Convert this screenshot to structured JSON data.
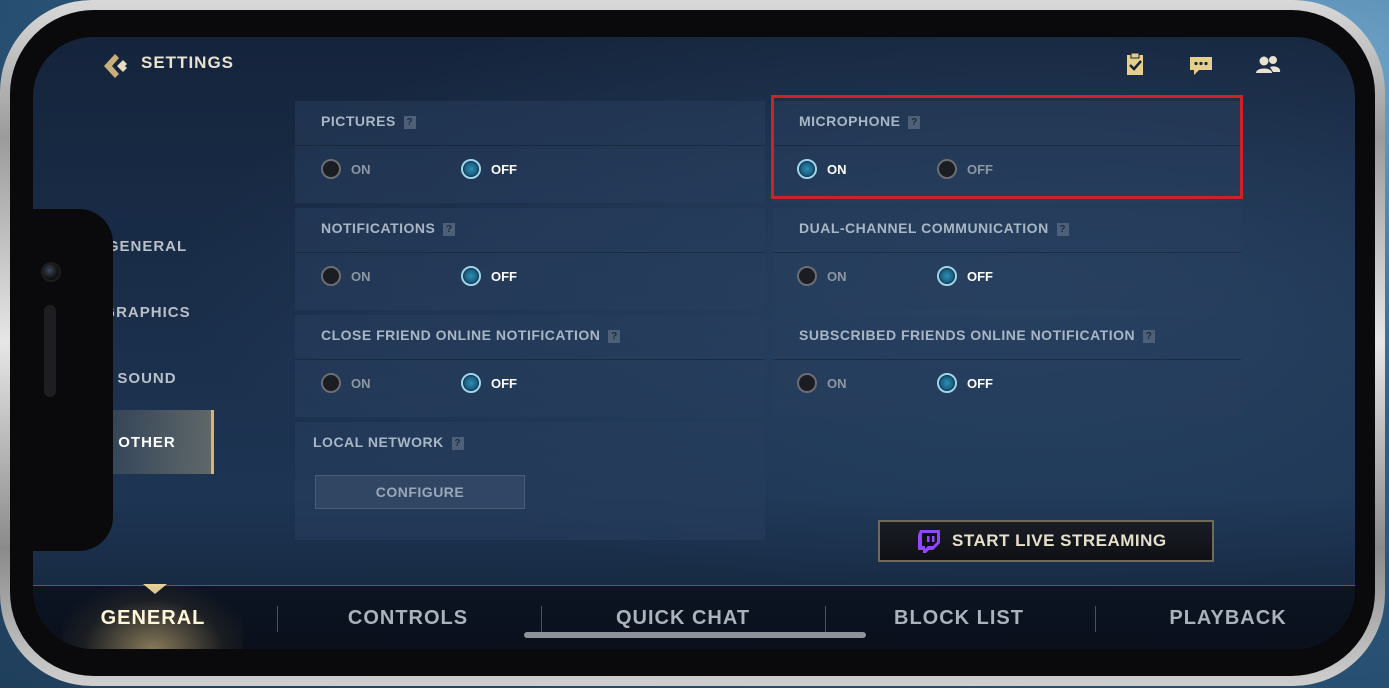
{
  "header": {
    "title": "SETTINGS",
    "icons": [
      "back-icon",
      "clipboard-check-icon",
      "chat-icon",
      "friends-icon"
    ]
  },
  "sidebar": {
    "items": [
      {
        "label": "GENERAL",
        "active": false
      },
      {
        "label": "GRAPHICS",
        "active": false
      },
      {
        "label": "SOUND",
        "active": false
      },
      {
        "label": "OTHER",
        "active": true
      }
    ]
  },
  "settings": {
    "pictures": {
      "label": "PICTURES",
      "hint": "?",
      "on": "ON",
      "off": "OFF",
      "selected": "OFF"
    },
    "microphone": {
      "label": "MICROPHONE",
      "hint": "?",
      "on": "ON",
      "off": "OFF",
      "selected": "ON"
    },
    "notifications": {
      "label": "NOTIFICATIONS",
      "hint": "?",
      "on": "ON",
      "off": "OFF",
      "selected": "OFF"
    },
    "dual_channel": {
      "label": "DUAL-CHANNEL COMMUNICATION",
      "hint": "?",
      "on": "ON",
      "off": "OFF",
      "selected": "OFF"
    },
    "close_friend": {
      "label": "CLOSE FRIEND ONLINE NOTIFICATION",
      "hint": "?",
      "on": "ON",
      "off": "OFF",
      "selected": "OFF"
    },
    "subscribed_friends": {
      "label": "SUBSCRIBED FRIENDS ONLINE NOTIFICATION",
      "hint": "?",
      "on": "ON",
      "off": "OFF",
      "selected": "OFF"
    },
    "local_network": {
      "label": "LOCAL NETWORK",
      "hint": "?",
      "button": "CONFIGURE"
    }
  },
  "stream": {
    "label": "START LIVE STREAMING",
    "icon": "twitch-icon"
  },
  "bottom_tabs": [
    {
      "label": "GENERAL",
      "active": true
    },
    {
      "label": "CONTROLS",
      "active": false
    },
    {
      "label": "QUICK CHAT",
      "active": false
    },
    {
      "label": "BLOCK LIST",
      "active": false
    },
    {
      "label": "PLAYBACK",
      "active": false
    }
  ],
  "colors": {
    "highlight": "#d0202a",
    "accent_gold": "#d7b56a",
    "radio_selected": "#2a8fb8",
    "twitch": "#9146ff"
  }
}
